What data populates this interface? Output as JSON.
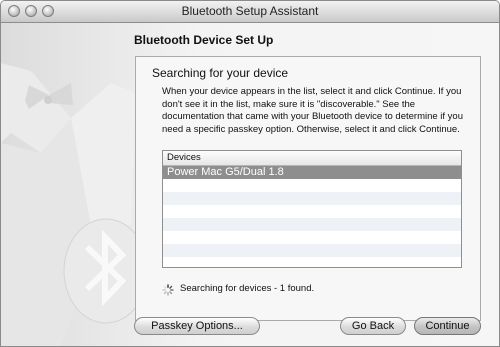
{
  "window": {
    "title": "Bluetooth Setup Assistant"
  },
  "page": {
    "heading": "Bluetooth Device Set Up",
    "panel_title": "Searching for your device",
    "instructions": "When your device appears in the list, select it and click Continue. If you don't see it in the list, make sure it is \"discoverable.\" See the documentation that came with your Bluetooth device to determine if you need a specific passkey option. Otherwise, select it and click Continue."
  },
  "device_list": {
    "header": "Devices",
    "items": [
      "Power Mac G5/Dual 1.8"
    ],
    "selected_index": 0
  },
  "status": {
    "text": "Searching for devices - 1 found."
  },
  "buttons": {
    "passkey": "Passkey Options...",
    "go_back": "Go Back",
    "continue": "Continue"
  },
  "icons": {
    "close": "close-button-icon",
    "minimize": "minimize-button-icon",
    "zoom": "zoom-button-icon",
    "spinner": "progress-spinner-icon",
    "bluetooth": "bluetooth-icon"
  }
}
